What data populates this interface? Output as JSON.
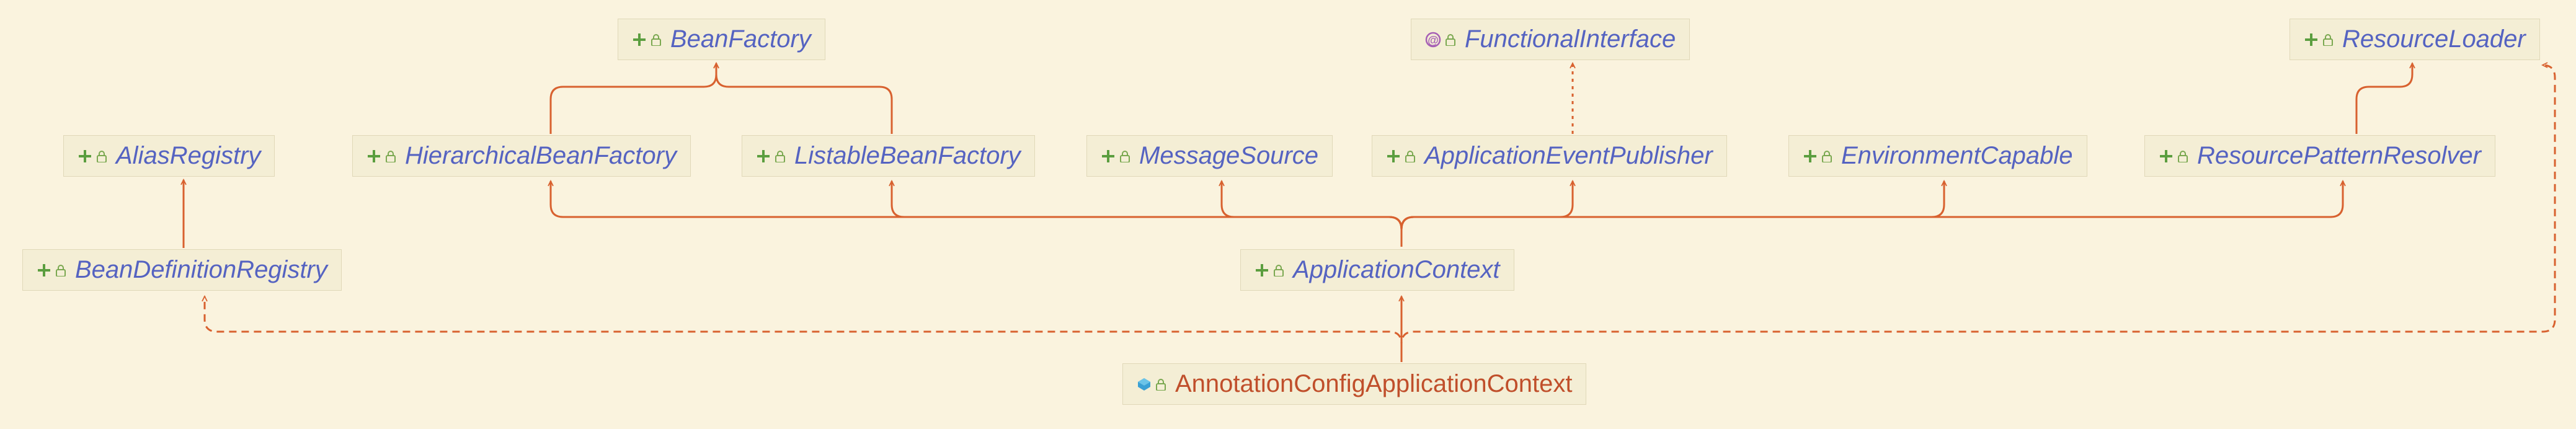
{
  "nodes": {
    "BeanFactory": {
      "label": "BeanFactory",
      "type": "interface"
    },
    "FunctionalInterface": {
      "label": "FunctionalInterface",
      "type": "annotation"
    },
    "ResourceLoader": {
      "label": "ResourceLoader",
      "type": "interface"
    },
    "AliasRegistry": {
      "label": "AliasRegistry",
      "type": "interface"
    },
    "HierarchicalBeanFactory": {
      "label": "HierarchicalBeanFactory",
      "type": "interface"
    },
    "ListableBeanFactory": {
      "label": "ListableBeanFactory",
      "type": "interface"
    },
    "MessageSource": {
      "label": "MessageSource",
      "type": "interface"
    },
    "ApplicationEventPublisher": {
      "label": "ApplicationEventPublisher",
      "type": "interface"
    },
    "EnvironmentCapable": {
      "label": "EnvironmentCapable",
      "type": "interface"
    },
    "ResourcePatternResolver": {
      "label": "ResourcePatternResolver",
      "type": "interface"
    },
    "BeanDefinitionRegistry": {
      "label": "BeanDefinitionRegistry",
      "type": "interface"
    },
    "ApplicationContext": {
      "label": "ApplicationContext",
      "type": "interface"
    },
    "AnnotationConfigApplicationContext": {
      "label": "AnnotationConfigApplicationContext",
      "type": "class"
    }
  },
  "relationships": [
    {
      "from": "HierarchicalBeanFactory",
      "to": "BeanFactory",
      "style": "solid"
    },
    {
      "from": "ListableBeanFactory",
      "to": "BeanFactory",
      "style": "solid"
    },
    {
      "from": "BeanDefinitionRegistry",
      "to": "AliasRegistry",
      "style": "solid"
    },
    {
      "from": "ApplicationEventPublisher",
      "to": "FunctionalInterface",
      "style": "dotted"
    },
    {
      "from": "ResourcePatternResolver",
      "to": "ResourceLoader",
      "style": "solid"
    },
    {
      "from": "ApplicationContext",
      "to": "HierarchicalBeanFactory",
      "style": "solid"
    },
    {
      "from": "ApplicationContext",
      "to": "ListableBeanFactory",
      "style": "solid"
    },
    {
      "from": "ApplicationContext",
      "to": "MessageSource",
      "style": "solid"
    },
    {
      "from": "ApplicationContext",
      "to": "ApplicationEventPublisher",
      "style": "solid"
    },
    {
      "from": "ApplicationContext",
      "to": "EnvironmentCapable",
      "style": "solid"
    },
    {
      "from": "ApplicationContext",
      "to": "ResourcePatternResolver",
      "style": "solid"
    },
    {
      "from": "AnnotationConfigApplicationContext",
      "to": "ApplicationContext",
      "style": "solid"
    },
    {
      "from": "AnnotationConfigApplicationContext",
      "to": "BeanDefinitionRegistry",
      "style": "dashed"
    },
    {
      "from": "AnnotationConfigApplicationContext",
      "to": "ResourceLoader",
      "style": "dashed"
    }
  ],
  "colors": {
    "background": "#faf3de",
    "nodeBackground": "#f4eed5",
    "interfaceText": "#5563c1",
    "classText": "#c04f2b",
    "connector": "#d8612f",
    "iconGreen": "#5b9e3f",
    "iconBlue": "#3aa0d4",
    "iconPurple": "#a65fb5"
  }
}
